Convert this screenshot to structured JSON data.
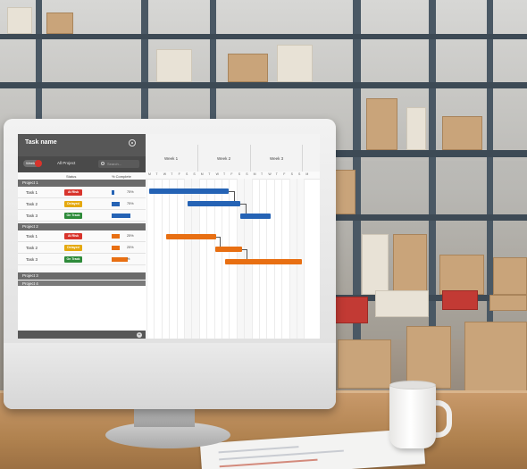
{
  "app": {
    "title": "Task name",
    "view_toggle_label": "Week",
    "project_filter": "All Project",
    "search_placeholder": "Search..."
  },
  "columns": {
    "status": "Status",
    "complete": "% Complete"
  },
  "groups": [
    {
      "name": "Project 1",
      "tasks": [
        {
          "name": "Task 1",
          "status": "At Risk",
          "status_color": "#d8342c",
          "complete": "75%",
          "complete_value": 0.15,
          "bar_color": "#2563b5"
        },
        {
          "name": "Task 2",
          "status": "Delayed",
          "status_color": "#e5a90f",
          "complete": "75%",
          "complete_value": 0.45,
          "bar_color": "#2563b5"
        },
        {
          "name": "Task 3",
          "status": "On Track",
          "status_color": "#2e8b3a",
          "complete": "",
          "complete_value": 1.0,
          "bar_color": "#2563b5"
        }
      ]
    },
    {
      "name": "Project 2",
      "tasks": [
        {
          "name": "Task 1",
          "status": "At Risk",
          "status_color": "#d8342c",
          "complete": "25%",
          "complete_value": 0.45,
          "bar_color": "#e86f12"
        },
        {
          "name": "Task 2",
          "status": "Delayed",
          "status_color": "#e5a90f",
          "complete": "25%",
          "complete_value": 0.45,
          "bar_color": "#e86f12"
        },
        {
          "name": "Task 3",
          "status": "On Track",
          "status_color": "#2e8b3a",
          "complete": "%",
          "complete_value": 0.85,
          "bar_color": "#e86f12"
        }
      ]
    },
    {
      "name": "Project 3",
      "tasks": []
    },
    {
      "name": "Project 4",
      "tasks": []
    }
  ],
  "gantt": {
    "weeks": [
      "Week 1",
      "Week 2",
      "Week 3"
    ],
    "days": [
      "M",
      "T",
      "W",
      "T",
      "F",
      "S",
      "S",
      "M",
      "T",
      "W",
      "T",
      "F",
      "S",
      "S",
      "M",
      "T",
      "W",
      "T",
      "F",
      "S",
      "S",
      "M"
    ],
    "colors": {
      "project_1": "#2563b5",
      "project_2": "#e86f12"
    }
  }
}
